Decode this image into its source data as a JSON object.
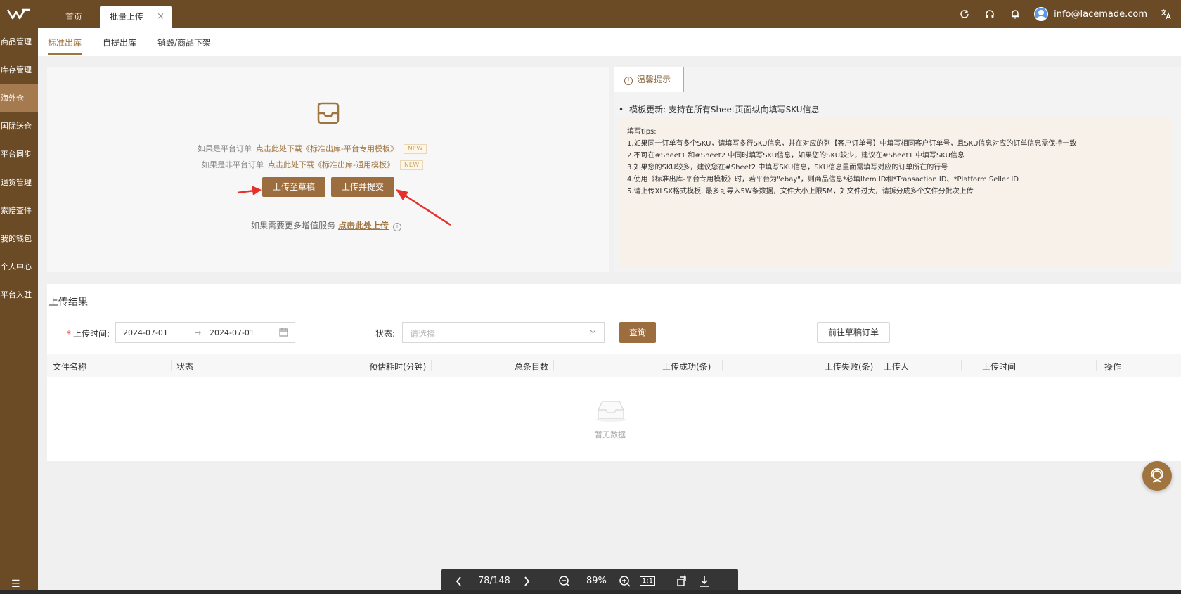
{
  "colors": {
    "brand": "#6b4a26",
    "accent": "#9c6d3f",
    "arrow": "#e8302a"
  },
  "topbar": {
    "tabs": [
      {
        "label": "首页"
      },
      {
        "label": "批量上传",
        "close": "×"
      }
    ],
    "user_email": "info@lacemade.com",
    "icons": [
      "refresh-icon",
      "headset-icon",
      "bell-icon",
      "avatar",
      "translate-icon"
    ]
  },
  "sidebar": {
    "items": [
      {
        "label": "商品管理"
      },
      {
        "label": "库存管理"
      },
      {
        "label": "海外仓"
      },
      {
        "label": "国际送仓"
      },
      {
        "label": "平台同步"
      },
      {
        "label": "退货管理"
      },
      {
        "label": "索赔查件"
      },
      {
        "label": "我的钱包"
      },
      {
        "label": "个人中心"
      },
      {
        "label": "平台入驻"
      }
    ],
    "active_index": 2,
    "menu_glyph": "☰"
  },
  "subtabs": [
    {
      "label": "标准出库"
    },
    {
      "label": "自提出库"
    },
    {
      "label": "销毁/商品下架"
    }
  ],
  "upload": {
    "line1_prefix": "如果是平台订单",
    "line1_link": "点击此处下载《标准出库-平台专用模板》",
    "line2_prefix": "如果是非平台订单",
    "line2_link": "点击此处下载《标准出库-通用模板》",
    "badge": "NEW",
    "btn_draft": "上传至草稿",
    "btn_submit": "上传并提交",
    "more_text": "如果需要更多增值服务",
    "more_link": "点击此处上传",
    "info_glyph": "i"
  },
  "tips": {
    "tab_label": "温馨提示",
    "tab_glyph": "!",
    "update": "模板更新: 支持在所有Sheet页面纵向填写SKU信息",
    "title": "填写tips:",
    "lines": [
      "1.如果同一订单有多个SKU，请填写多行SKU信息，并在对应的列【客户订单号】中填写相同客户订单号，且SKU信息对应的订单信息需保持一致",
      "2.不可在#Sheet1 和#Sheet2 中同时填写SKU信息，如果您的SKU较少，建议在#Sheet1 中填写SKU信息",
      "3.如果您的SKU较多，建议您在#Sheet2 中填写SKU信息，SKU信息里面需填写对应的订单所在的行号",
      "4.使用《标准出库-平台专用模板》时，若平台为\"ebay\"，则商品信息*必填Item ID和*Transaction ID、*Platform Seller ID",
      "5.请上传XLSX格式模板, 最多可导入5W条数据，文件大小上限5M，如文件过大，请拆分成多个文件分批次上传"
    ]
  },
  "results": {
    "title": "上传结果",
    "date_label": "上传时间:",
    "date_required": "*",
    "date_from": "2024-07-01",
    "date_sep": "→",
    "date_to": "2024-07-01",
    "status_label": "状态:",
    "status_placeholder": "请选择",
    "query_btn": "查询",
    "draft_btn": "前往草稿订单",
    "columns": [
      "文件名称",
      "状态",
      "预估耗时(分钟)",
      "总条目数",
      "上传成功(条)",
      "上传失败(条)",
      "上传人",
      "上传时间",
      "操作"
    ],
    "empty": "暂无数据"
  },
  "pdfbar": {
    "page": "78/148",
    "zoom": "89%",
    "actual_size": "1:1"
  }
}
